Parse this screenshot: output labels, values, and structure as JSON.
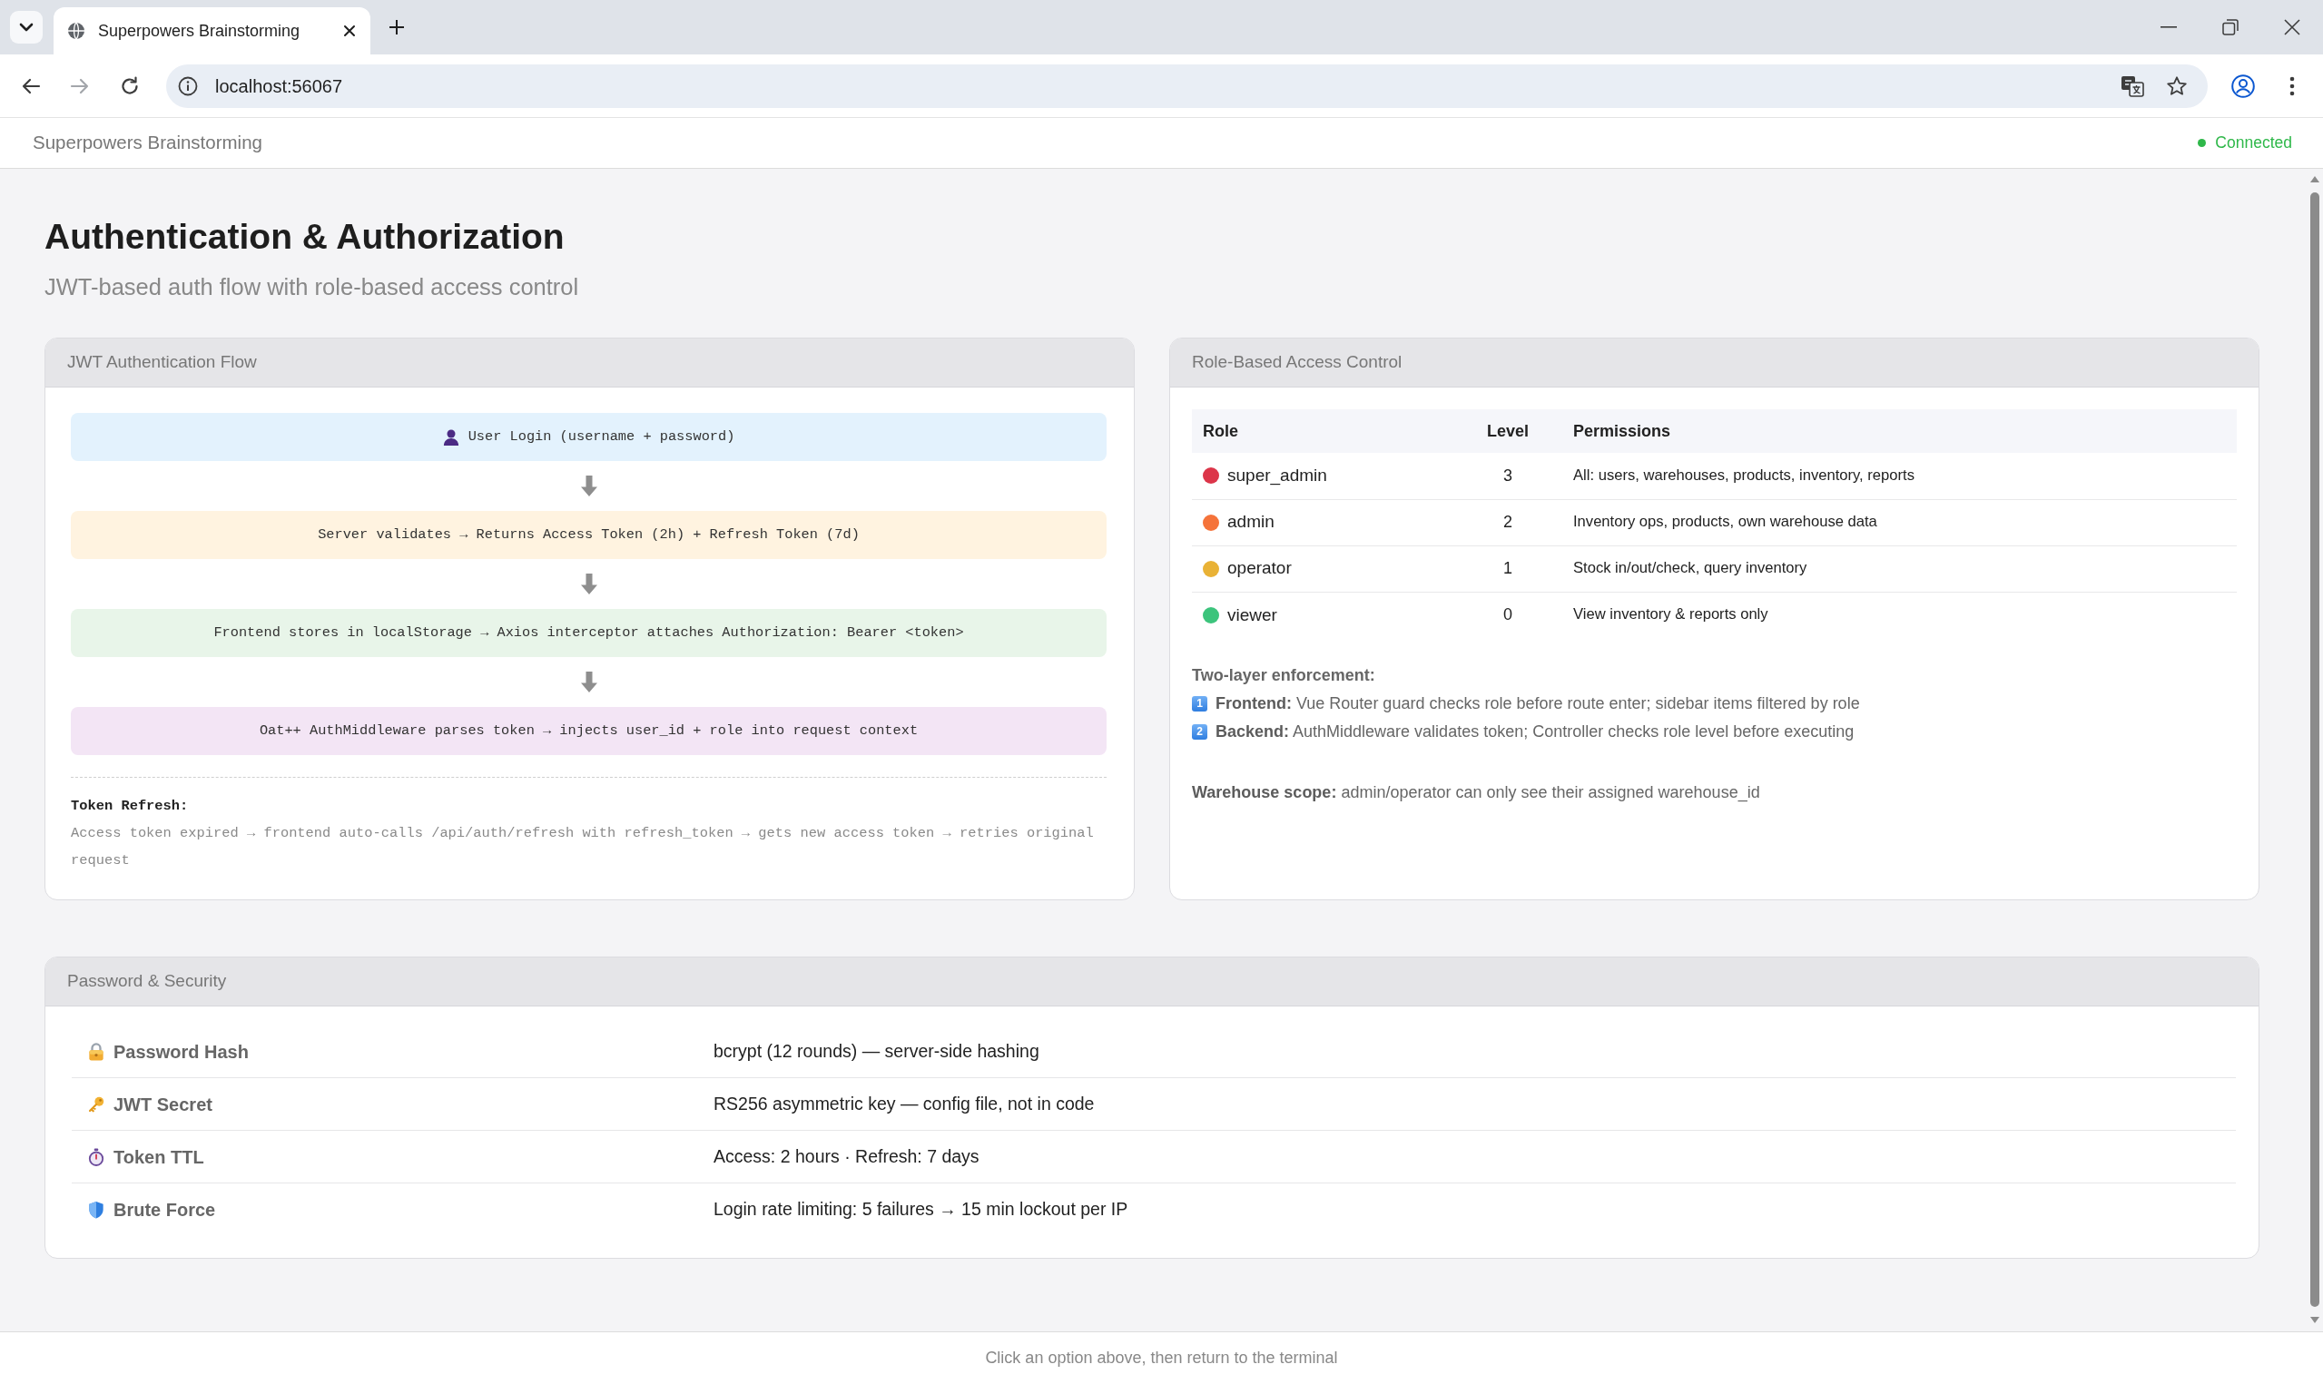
{
  "browser": {
    "tabs": [
      {
        "title": "Superpowers Brainstorming",
        "selected": true
      }
    ],
    "back_disabled": false,
    "forward_disabled": true,
    "address": "localhost:56067"
  },
  "app_header": {
    "title": "Superpowers Brainstorming",
    "status": {
      "text": "Connected",
      "connected": true
    }
  },
  "page": {
    "title": "Authentication & Authorization",
    "subtitle": "JWT-based auth flow with role-based access control"
  },
  "auth_flow": {
    "title": "JWT Authentication Flow",
    "steps": [
      {
        "kind": "actor",
        "text": "User Login (username + password)",
        "color": "#e3f2fd"
      },
      {
        "kind": "process",
        "text": "Server validates → Returns Access Token (2h) + Refresh Token (7d)",
        "color": "#fff3e0"
      },
      {
        "kind": "process",
        "text": "Frontend stores in localStorage → Axios interceptor attaches Authorization: Bearer <token>",
        "color": "#e8f5e9"
      },
      {
        "kind": "process",
        "text": "Oat++ AuthMiddleware parses token → injects user_id + role into request context",
        "color": "#f3e5f5"
      }
    ],
    "refresh": {
      "heading": "Token Refresh:",
      "text": "Access token expired → frontend auto-calls /api/auth/refresh with refresh_token → gets new access token → retries original request"
    }
  },
  "access_control": {
    "title": "Role-Based Access Control",
    "table": {
      "columns": [
        "Role",
        "Level",
        "Permissions"
      ],
      "rows": [
        {
          "color": "#dc3549",
          "cells": [
            "super_admin",
            "3",
            "All: users, warehouses, products, inventory, reports"
          ]
        },
        {
          "color": "#f5733a",
          "cells": [
            "admin",
            "2",
            "Inventory ops, products, own warehouse data"
          ]
        },
        {
          "color": "#e9b236",
          "cells": [
            "operator",
            "1",
            "Stock in/out/check, query inventory"
          ]
        },
        {
          "color": "#3cc47c",
          "cells": [
            "viewer",
            "0",
            "View inventory & reports only"
          ]
        }
      ]
    },
    "enforcement": {
      "heading": "Two-layer enforcement:",
      "items": [
        {
          "number": "1",
          "text": "**Frontend:** Vue Router guard checks role before route enter; sidebar items filtered by role"
        },
        {
          "number": "2",
          "text": "**Backend:** AuthMiddleware validates token; Controller checks role level before executing"
        }
      ]
    },
    "scope": "**Warehouse scope:** admin/operator can only see their assigned warehouse_id"
  },
  "security": {
    "title": "Password & Security",
    "rows": [
      {
        "kind": "lock",
        "label": "Password Hash",
        "value": "bcrypt (12 rounds) — server-side hashing"
      },
      {
        "kind": "key",
        "label": "JWT Secret",
        "value": "RS256 asymmetric key — config file, not in code"
      },
      {
        "kind": "stopwatch",
        "label": "Token TTL",
        "value": "Access: 2 hours · Refresh: 7 days"
      },
      {
        "kind": "shield",
        "label": "Brute Force",
        "value": "Login rate limiting: 5 failures → 15 min lockout per IP"
      }
    ]
  },
  "footer": {
    "hint": "Click an option above, then return to the terminal"
  }
}
